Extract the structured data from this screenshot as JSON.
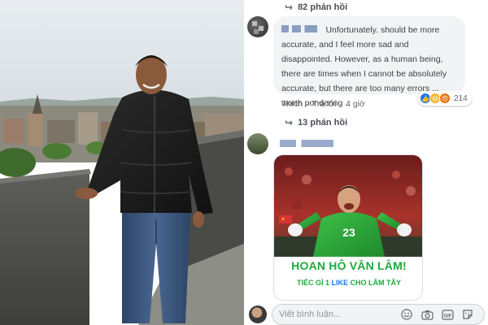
{
  "comments": {
    "top_replies_label": "82 phản hồi",
    "comment": {
      "text": "Unfortunately. should be more accurate, and I feel more sad and disappointed. However, as a human being, there are times when I cannot be absolutely accurate, but there are too many errors ... worth pondering ..",
      "actions": {
        "like": "Thích",
        "reply": "Trả lời",
        "time": "4 giờ"
      },
      "reaction_count": "214"
    },
    "second_replies_label": "13 phản hồi",
    "shared_card": {
      "jersey_number": "23",
      "title": "HOAN HÔ VĂN LÂM!",
      "subtitle_pre": "TIẾC GÌ 1 ",
      "subtitle_like": "LIKE",
      "subtitle_post": " CHO LÂM TÂY"
    },
    "composer_placeholder": "Viết bình luận..."
  },
  "icons": {
    "reply": "reply-arrow-icon",
    "reactions": [
      "like-reaction-icon",
      "haha-reaction-icon",
      "angry-reaction-icon"
    ],
    "composer": [
      "emoji-icon",
      "camera-icon",
      "gif-icon",
      "sticker-icon"
    ]
  },
  "colors": {
    "facebook_blue": "#1877f2",
    "card_green": "#1faa3c",
    "bubble_gray": "#f2f3f5",
    "meta_gray": "#606770"
  }
}
